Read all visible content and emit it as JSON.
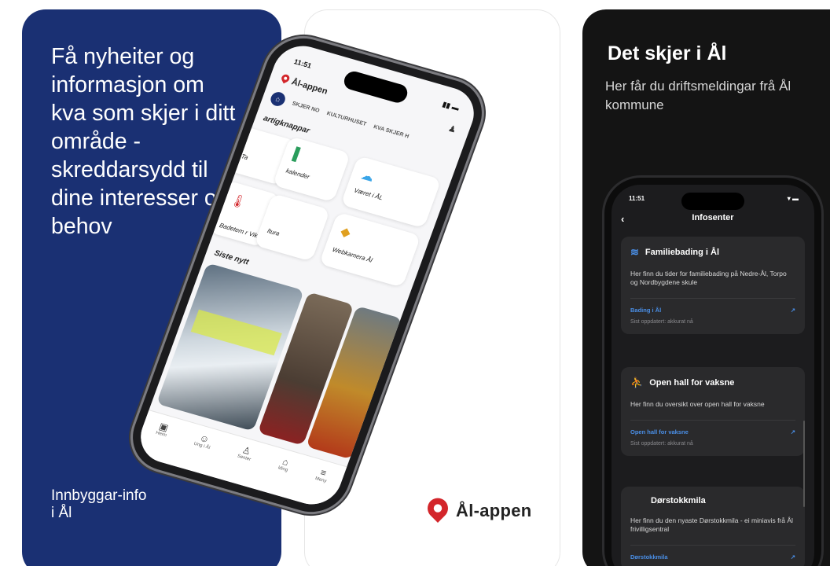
{
  "card1": {
    "headline": "Få nyheiter og\ninformasjon om\nkva som skjer i ditt\nområde -\nskreddarsydd til\ndine interesser og\nbehov",
    "footer": "Innbyggar-info\ni Ål"
  },
  "card2": {
    "brand_name": "Ål-appen",
    "phone": {
      "status_time": "11:51",
      "app_name": "Ål-appen",
      "tabs": [
        "SKJER NO",
        "KULTURHUSET",
        "KVA SKJER H"
      ],
      "section_shortcuts": "artigknappar",
      "tiles": [
        "Ta",
        "kalender",
        "Været i ÅL",
        "Badetem r Viken",
        "ltura",
        "Webkamera Ål"
      ],
      "section_news": "Siste nytt",
      "tabbar": [
        "Heim",
        "Ung i Ål",
        "Senter",
        "lding",
        "Meny"
      ]
    }
  },
  "card3": {
    "title": "Det skjer i Ål",
    "subtitle": "Her får du driftsmeldingar frå Ål kommune",
    "phone": {
      "status_time": "11:51",
      "nav_title": "Infosenter",
      "items": [
        {
          "title": "Familiebading i Ål",
          "desc": "Her finn du tider for familiebading på Nedre-Ål, Torpo og Nordbygdene skule",
          "link": "Bading i Ål",
          "updated": "Sist oppdatert: akkurat nå"
        },
        {
          "title": "Open hall for vaksne",
          "desc": "Her finn du oversikt over open hall for vaksne",
          "link": "Open hall for vaksne",
          "updated": "Sist oppdatert: akkurat nå"
        },
        {
          "title": "Dørstokkmila",
          "desc": "Her finn du den nyaste Dørstokkmila - ei miniavis frå Ål frivilligsentral",
          "link": "Dørstokkmila",
          "updated": ""
        }
      ]
    }
  },
  "colors": {
    "blue": "#1a3073",
    "dark": "#141414",
    "accent_red": "#d3262b",
    "link_blue": "#4a8fe7"
  }
}
